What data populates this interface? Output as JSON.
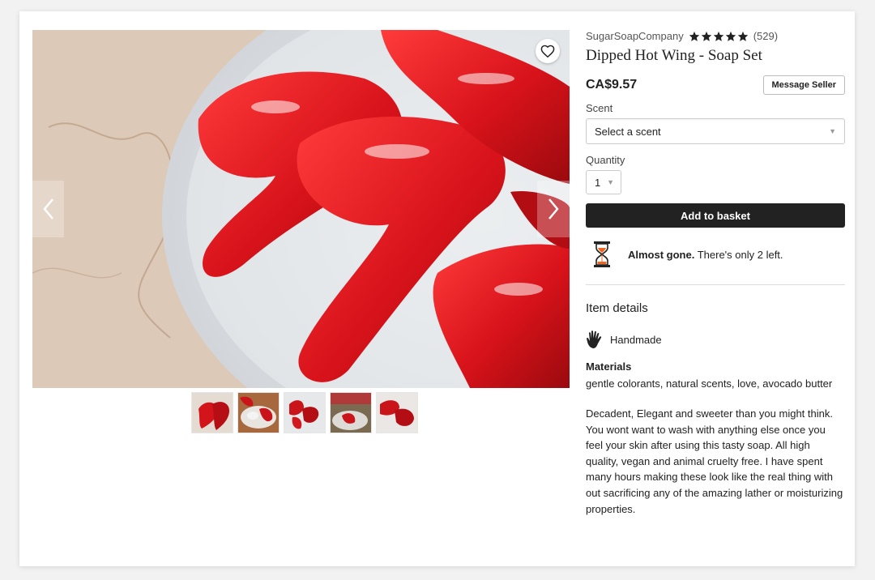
{
  "listing": {
    "shop_name": "SugarSoapCompany",
    "rating_stars": 5,
    "review_count": "(529)",
    "title": "Dipped Hot Wing - Soap Set",
    "price": "CA$9.57",
    "message_seller": "Message Seller",
    "scent_label": "Scent",
    "scent_value": "Select a scent",
    "quantity_label": "Quantity",
    "quantity_value": "1",
    "add_to_basket": "Add to basket",
    "scarcity_bold": "Almost gone.",
    "scarcity_text": " There's only 2 left.",
    "details_heading": "Item details",
    "handmade": "Handmade",
    "materials_label": "Materials",
    "materials": "gentle colorants, natural scents, love, avocado butter",
    "description": "Decadent, Elegant and sweeter than you might think. You wont want to wash with anything else once you feel your skin after using this tasty soap. All high quality, vegan and animal cruelty free. I have spent many hours making these look like the real thing with out sacrificing any of the amazing lather or moisturizing properties."
  },
  "gallery": {
    "thumbnail_count": 5
  },
  "icons": {
    "favorite": "heart-icon",
    "prev": "chevron-left-icon",
    "next": "chevron-right-icon",
    "scarcity": "hourglass-icon",
    "handmade": "hand-icon",
    "star": "star-icon",
    "dropdown": "caret-down-icon"
  },
  "colors": {
    "accent_button": "#222222",
    "hourglass": "#f1641e"
  }
}
